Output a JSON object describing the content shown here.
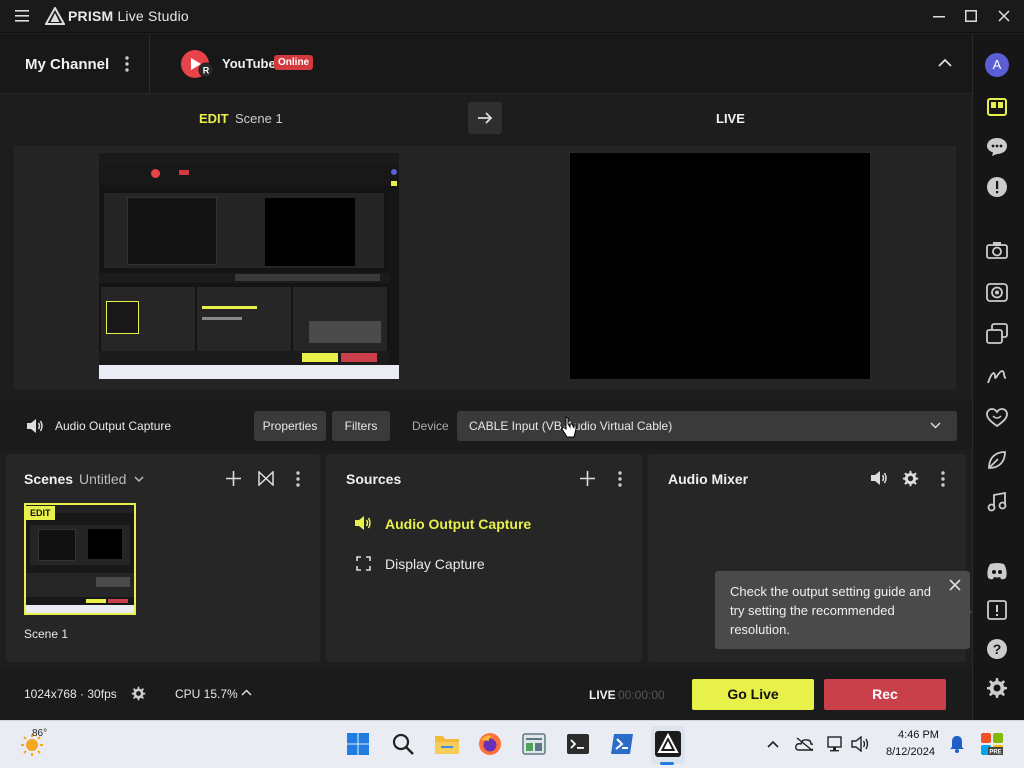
{
  "app": {
    "title_bold": "PRISM",
    "title_light": "Live Studio"
  },
  "channel": {
    "my_channel": "My Channel",
    "platform": "YouTube",
    "status": "Online",
    "avatar_letter": "A",
    "yt_sub_letter": "R"
  },
  "preview": {
    "edit_label": "EDIT",
    "scene_label": "Scene 1",
    "live_label": "LIVE"
  },
  "source_bar": {
    "selected_source": "Audio Output Capture",
    "properties_label": "Properties",
    "filters_label": "Filters",
    "device_label": "Device",
    "device_value": "CABLE Input (VB-Audio Virtual Cable)"
  },
  "scenes": {
    "title": "Scenes",
    "collection": "Untitled",
    "thumb_badge": "EDIT",
    "items": [
      {
        "name": "Scene 1"
      }
    ]
  },
  "sources": {
    "title": "Sources",
    "items": [
      {
        "name": "Audio Output Capture",
        "icon": "speaker-icon",
        "active": true
      },
      {
        "name": "Display Capture",
        "icon": "capture-frame-icon",
        "active": false
      }
    ]
  },
  "mixer": {
    "title": "Audio Mixer"
  },
  "tooltip": {
    "text": "Check the output setting guide and try setting the recommended resolution."
  },
  "status": {
    "resolution": "1024x768 · 30fps",
    "cpu": "CPU 15.7%",
    "live_label": "LIVE",
    "live_timer": "00:00:00",
    "go_live": "Go Live",
    "rec": "Rec"
  },
  "taskbar": {
    "weather": "86°",
    "time": "4:46 PM",
    "date": "8/12/2024"
  },
  "colors": {
    "accent_yellow": "#e8f04a",
    "rec_red": "#c9404b",
    "online_red": "#d23a40",
    "avatar_purple": "#5b5fd6"
  }
}
